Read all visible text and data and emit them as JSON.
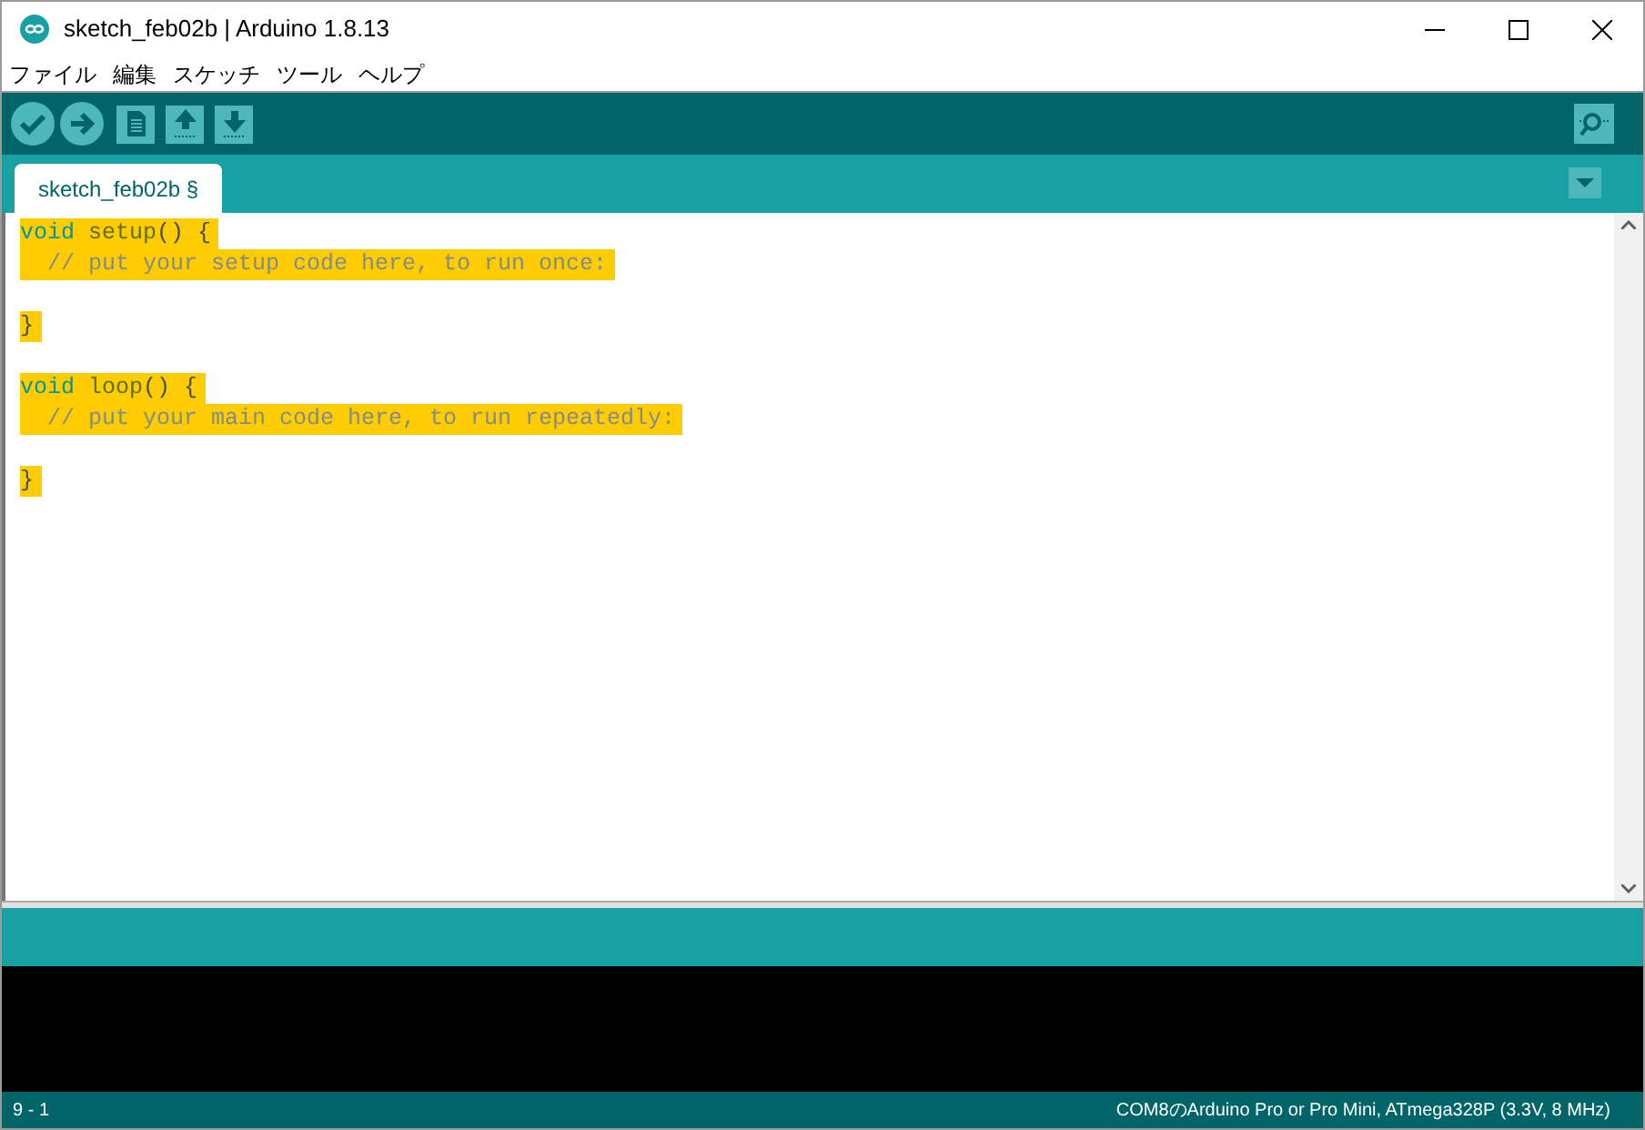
{
  "window": {
    "title": "sketch_feb02b | Arduino 1.8.13"
  },
  "menu": [
    "ファイル",
    "編集",
    "スケッチ",
    "ツール",
    "ヘルプ"
  ],
  "toolbar": [
    {
      "kind": "verify"
    },
    {
      "kind": "upload"
    },
    {
      "kind": "new"
    },
    {
      "kind": "open"
    },
    {
      "kind": "save"
    }
  ],
  "tabs": [
    {
      "label": "sketch_feb02b §",
      "selected": true
    }
  ],
  "editor": {
    "lines": [
      {
        "selected": true,
        "tokens": [
          {
            "text": "void",
            "kind": "type"
          },
          {
            "text": " setup",
            "kind": "func"
          },
          {
            "text": "()",
            "kind": "punct"
          },
          {
            "text": " {",
            "kind": "brace"
          }
        ]
      },
      {
        "selected": true,
        "tokens": [
          {
            "text": "  // put your setup code here, to run once:",
            "kind": "comment"
          }
        ]
      },
      {
        "selected": false
      },
      {
        "selected": true,
        "tokens": [
          {
            "text": "}",
            "kind": "brace"
          }
        ]
      },
      {
        "selected": false
      },
      {
        "selected": true,
        "tokens": [
          {
            "text": "void",
            "kind": "type"
          },
          {
            "text": " loop",
            "kind": "func"
          },
          {
            "text": "()",
            "kind": "punct"
          },
          {
            "text": " {",
            "kind": "brace"
          }
        ]
      },
      {
        "selected": true,
        "tokens": [
          {
            "text": "  // put your main code here, to run repeatedly:",
            "kind": "comment"
          }
        ]
      },
      {
        "selected": false
      },
      {
        "selected": true,
        "tokens": [
          {
            "text": "}",
            "kind": "brace"
          }
        ]
      }
    ]
  },
  "status_bar": {
    "position": "9 - 1",
    "board": "COM8のArduino Pro or Pro Mini, ATmega328P (3.3V, 8 MHz)"
  }
}
